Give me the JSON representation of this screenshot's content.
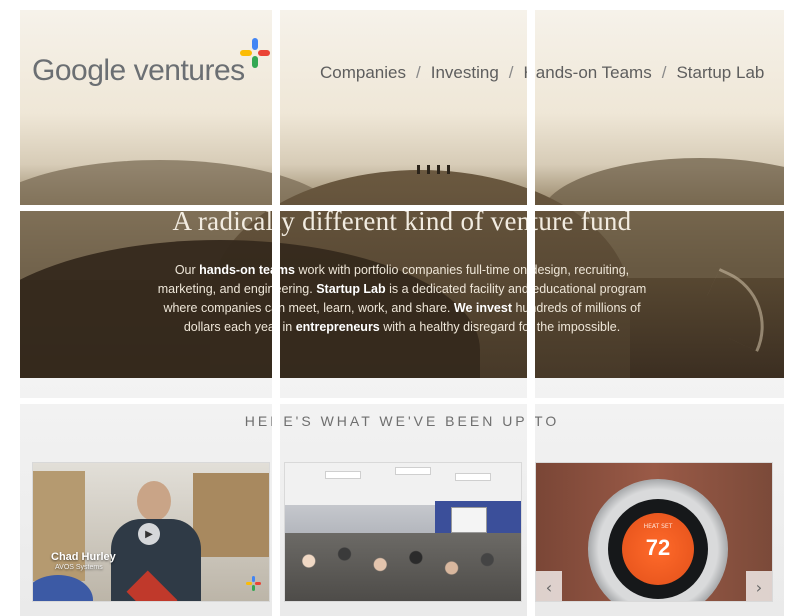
{
  "brand": {
    "name": "Google ventures",
    "accent_colors": [
      "#4285f4",
      "#ea4335",
      "#fbbc05",
      "#34a853"
    ]
  },
  "nav": {
    "items": [
      {
        "label": "Companies"
      },
      {
        "label": "Investing"
      },
      {
        "label": "Hands-on Teams"
      },
      {
        "label": "Startup Lab"
      }
    ],
    "separator": "/"
  },
  "hero": {
    "title": "A radically different kind of venture fund",
    "copy": {
      "p1a": "Our ",
      "p1b": "hands-on teams",
      "p1c": " work with portfolio companies full-time on design, recruiting, marketing, and engineering. ",
      "p1d": "Startup Lab",
      "p1e": " is a dedicated facility and educational program where companies can meet, learn, work, and share. ",
      "p1f": "We invest",
      "p1g": " hundreds of millions of dollars each year in ",
      "p1h": "entrepreneurs",
      "p1i": " with a healthy disregard for the impossible."
    }
  },
  "section": {
    "heading": "HERE'S WHAT WE'VE BEEN UP TO"
  },
  "tiles": [
    {
      "caption_name": "Chad Hurley",
      "caption_sub": "AVOS Systems",
      "icon": "play-icon"
    },
    {
      "icon": "classroom-photo"
    },
    {
      "display_value": "72",
      "display_label": "HEAT SET",
      "icons": [
        "arrow-left-icon",
        "arrow-right-icon"
      ]
    }
  ]
}
